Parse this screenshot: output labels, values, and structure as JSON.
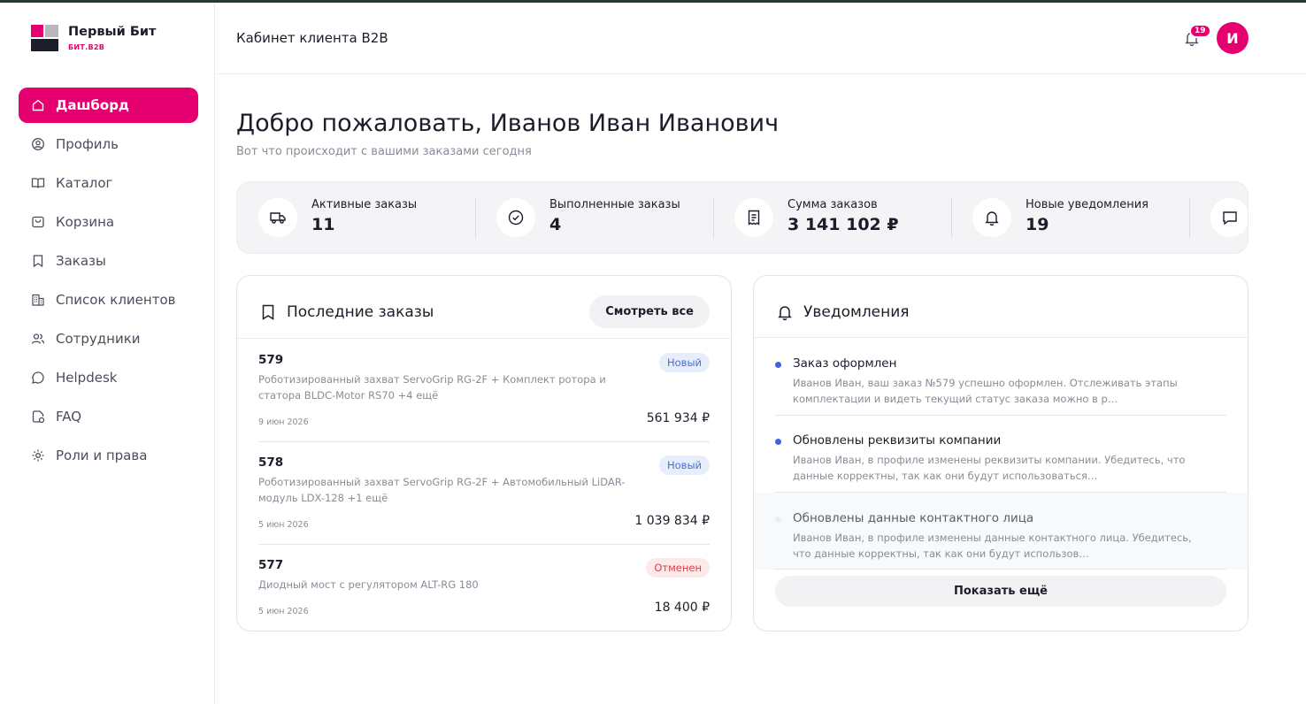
{
  "brand": {
    "name": "Первый Бит",
    "sub": "БИТ.B2B",
    "accent": "#e6006f"
  },
  "header": {
    "title": "Кабинет клиента B2B",
    "notifications_count": "19",
    "avatar_letter": "И"
  },
  "sidebar": {
    "items": [
      {
        "label": "Дашборд",
        "icon": "home-icon",
        "active": true
      },
      {
        "label": "Профиль",
        "icon": "user-circle-icon"
      },
      {
        "label": "Каталог",
        "icon": "book-icon"
      },
      {
        "label": "Корзина",
        "icon": "basket-icon"
      },
      {
        "label": "Заказы",
        "icon": "bookmark-icon"
      },
      {
        "label": "Список клиентов",
        "icon": "buildings-icon"
      },
      {
        "label": "Сотрудники",
        "icon": "users-icon"
      },
      {
        "label": "Helpdesk",
        "icon": "chat-bubble-icon"
      },
      {
        "label": "FAQ",
        "icon": "faq-icon"
      },
      {
        "label": "Роли и права",
        "icon": "gear-icon"
      }
    ]
  },
  "main": {
    "welcome": "Добро пожаловать, Иванов Иван Иванович",
    "subtitle": "Вот что происходит с вашими заказами сегодня",
    "stats": [
      {
        "label": "Активные заказы",
        "value": "11",
        "icon": "truck-icon"
      },
      {
        "label": "Выполненные заказы",
        "value": "4",
        "icon": "check-circle-icon"
      },
      {
        "label": "Сумма заказов",
        "value": "3 141 102 ₽",
        "icon": "receipt-icon"
      },
      {
        "label": "Новые уведомления",
        "value": "19",
        "icon": "bell-icon"
      },
      {
        "label": "",
        "value": "",
        "icon": "chat-icon"
      }
    ]
  },
  "orders": {
    "title": "Последние заказы",
    "see_all": "Смотреть все",
    "items": [
      {
        "number": "579",
        "status": "Новый",
        "description": "Роботизированный захват ServoGrip RG-2F + Комплект ротора и статора BLDC-Motor RS70 +4 ещё",
        "date": "9 июн 2026",
        "sum": "561 934 ₽"
      },
      {
        "number": "578",
        "status": "Новый",
        "description": "Роботизированный захват ServoGrip RG-2F + Автомобильный LiDAR-модуль LDX-128 +1 ещё",
        "date": "5 июн 2026",
        "sum": "1 039 834 ₽"
      },
      {
        "number": "577",
        "status": "Отменен",
        "description": "Диодный мост с регулятором ALT-RG 180",
        "date": "5 июн 2026",
        "sum": "18 400 ₽"
      }
    ]
  },
  "notifications": {
    "title": "Уведомления",
    "show_more": "Показать ещё",
    "items": [
      {
        "title": "Заказ оформлен",
        "text": "Иванов Иван, ваш заказ №579 успешно оформлен. Отслеживать этапы комплектации и видеть текущий статус заказа можно в р…"
      },
      {
        "title": "Обновлены реквизиты компании",
        "text": "Иванов Иван, в профиле изменены реквизиты компании. Убедитесь, что данные корректны, так как они будут использоваться…"
      },
      {
        "title": "Обновлены данные контактного лица",
        "text": "Иванов Иван, в профиле изменены данные контактного лица. Убедитесь, что данные корректны, так как они будут использов…"
      }
    ]
  }
}
